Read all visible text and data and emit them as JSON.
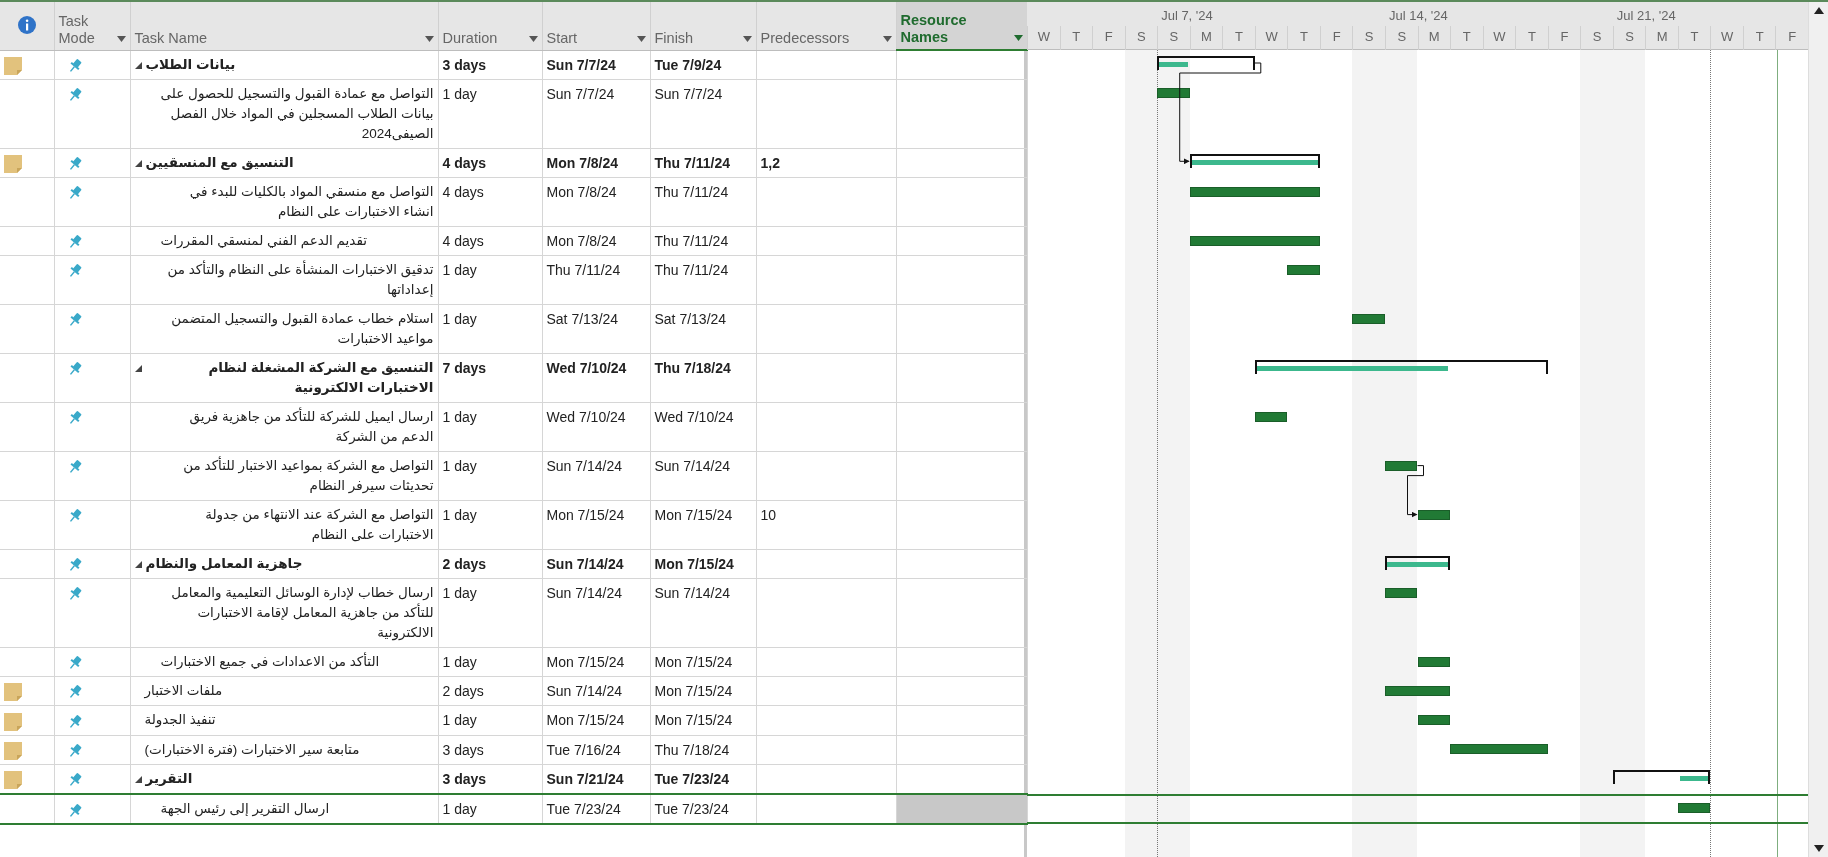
{
  "columns": [
    {
      "label": "Task Mode",
      "sorted": false
    },
    {
      "label": "Task Name",
      "sorted": false
    },
    {
      "label": "Duration",
      "sorted": false
    },
    {
      "label": "Start",
      "sorted": false
    },
    {
      "label": "Finish",
      "sorted": false
    },
    {
      "label": "Predecessors",
      "sorted": false
    },
    {
      "label": "Resource Names",
      "sorted": true
    }
  ],
  "timescale": {
    "weeks": [
      "Jul 7, '24",
      "Jul 14, '24",
      "Jul 21, '24"
    ],
    "days": [
      "W",
      "T",
      "F",
      "S",
      "S",
      "M",
      "T",
      "W",
      "T",
      "F",
      "S",
      "S",
      "M",
      "T",
      "W",
      "T",
      "F",
      "S",
      "S",
      "M",
      "T",
      "W",
      "T",
      "F"
    ]
  },
  "tasks": [
    {
      "name": "بيانات الطلاب",
      "duration": "3 days",
      "start": "Sun 7/7/24",
      "finish": "Tue 7/9/24",
      "note": true,
      "expanded": true,
      "selected": false,
      "children": [
        {
          "name": "التواصل مع عمادة القبول والتسجيل للحصول على بيانات الطلاب المسجلين في المواد خلال الفصل الصيفى2024",
          "duration": "1 day",
          "start": "Sun 7/7/24",
          "finish": "Sun 7/7/24",
          "note": false,
          "selected": false
        }
      ]
    },
    {
      "name": "التنسيق مع المنسقيين",
      "duration": "4 days",
      "start": "Mon 7/8/24",
      "finish": "Thu 7/11/24",
      "predecessors": "1,2",
      "note": true,
      "expanded": true,
      "selected": false,
      "children": [
        {
          "name": "التواصل مع منسقي المواد بالكليات للبدء في انشاء الاختبارات على النظام",
          "duration": "4 days",
          "start": "Mon 7/8/24",
          "finish": "Thu 7/11/24",
          "note": false,
          "selected": false
        },
        {
          "name": "تقديم الدعم الفني لمنسقي المقررات",
          "duration": "4 days",
          "start": "Mon 7/8/24",
          "finish": "Thu 7/11/24",
          "note": false,
          "selected": false
        },
        {
          "name": "تدقيق الاختبارات المنشأة على النظام والتأكد من إعداداتها",
          "duration": "1 day",
          "start": "Thu 7/11/24",
          "finish": "Thu 7/11/24",
          "note": false,
          "selected": false
        },
        {
          "name": "استلام خطاب عمادة القبول والتسجيل المتضمن مواعيد الاختبارات",
          "duration": "1 day",
          "start": "Sat 7/13/24",
          "finish": "Sat 7/13/24",
          "note": false,
          "selected": false
        }
      ]
    },
    {
      "name": "التنسيق مع الشركة المشغلة لنظام الاختبارات الالكترونية",
      "duration": "7 days",
      "start": "Wed 7/10/24",
      "finish": "Thu 7/18/24",
      "note": false,
      "expanded": true,
      "selected": false,
      "children": [
        {
          "name": "ارسال ايميل للشركة للتأكد من جاهزية فريق الدعم من الشركة",
          "duration": "1 day",
          "start": "Wed 7/10/24",
          "finish": "Wed 7/10/24",
          "note": false,
          "selected": false
        },
        {
          "name": "التواصل مع الشركة بمواعيد الاختبار للتأكد من تحديثات سيرفر النظام",
          "duration": "1 day",
          "start": "Sun 7/14/24",
          "finish": "Sun 7/14/24",
          "note": false,
          "selected": false
        },
        {
          "name": "التواصل مع الشركة عند الانتهاء من جدولة الاختبارات على النظام",
          "duration": "1 day",
          "start": "Mon 7/15/24",
          "finish": "Mon 7/15/24",
          "predecessors": "10",
          "note": false,
          "selected": false
        }
      ]
    },
    {
      "name": "جاهزية المعامل والنظام",
      "duration": "2 days",
      "start": "Sun 7/14/24",
      "finish": "Mon 7/15/24",
      "note": false,
      "expanded": true,
      "selected": false,
      "children": [
        {
          "name": "ارسال خطاب لإدارة الوسائل التعليمية والمعامل للتأكد من جاهزية المعامل لإقامة الاختبارات الالكترونية",
          "duration": "1 day",
          "start": "Sun 7/14/24",
          "finish": "Sun 7/14/24",
          "note": false,
          "selected": false
        },
        {
          "name": "التأكد من الاعدادات في جميع الاختبارات",
          "duration": "1 day",
          "start": "Mon 7/15/24",
          "finish": "Mon 7/15/24",
          "note": false,
          "selected": false
        }
      ]
    },
    {
      "name": "ملفات الاختبار",
      "duration": "2 days",
      "start": "Sun 7/14/24",
      "finish": "Mon 7/15/24",
      "note": true,
      "selected": false
    },
    {
      "name": "تنفيذ الجدولة",
      "duration": "1 day",
      "start": "Mon 7/15/24",
      "finish": "Mon 7/15/24",
      "note": true,
      "selected": false
    },
    {
      "name": "متابعة سير الاختبارات (فترة الاختبارات)",
      "duration": "3 days",
      "start": "Tue 7/16/24",
      "finish": "Thu 7/18/24",
      "note": true,
      "selected": false
    },
    {
      "name": "التقرير",
      "duration": "3 days",
      "start": "Sun 7/21/24",
      "finish": "Tue 7/23/24",
      "note": true,
      "expanded": true,
      "selected": false,
      "children": [
        {
          "name": "ارسال التقرير إلى رئيس الجهة",
          "duration": "1 day",
          "start": "Tue 7/23/24",
          "finish": "Tue 7/23/24",
          "note": false,
          "selected": true
        }
      ]
    }
  ]
}
